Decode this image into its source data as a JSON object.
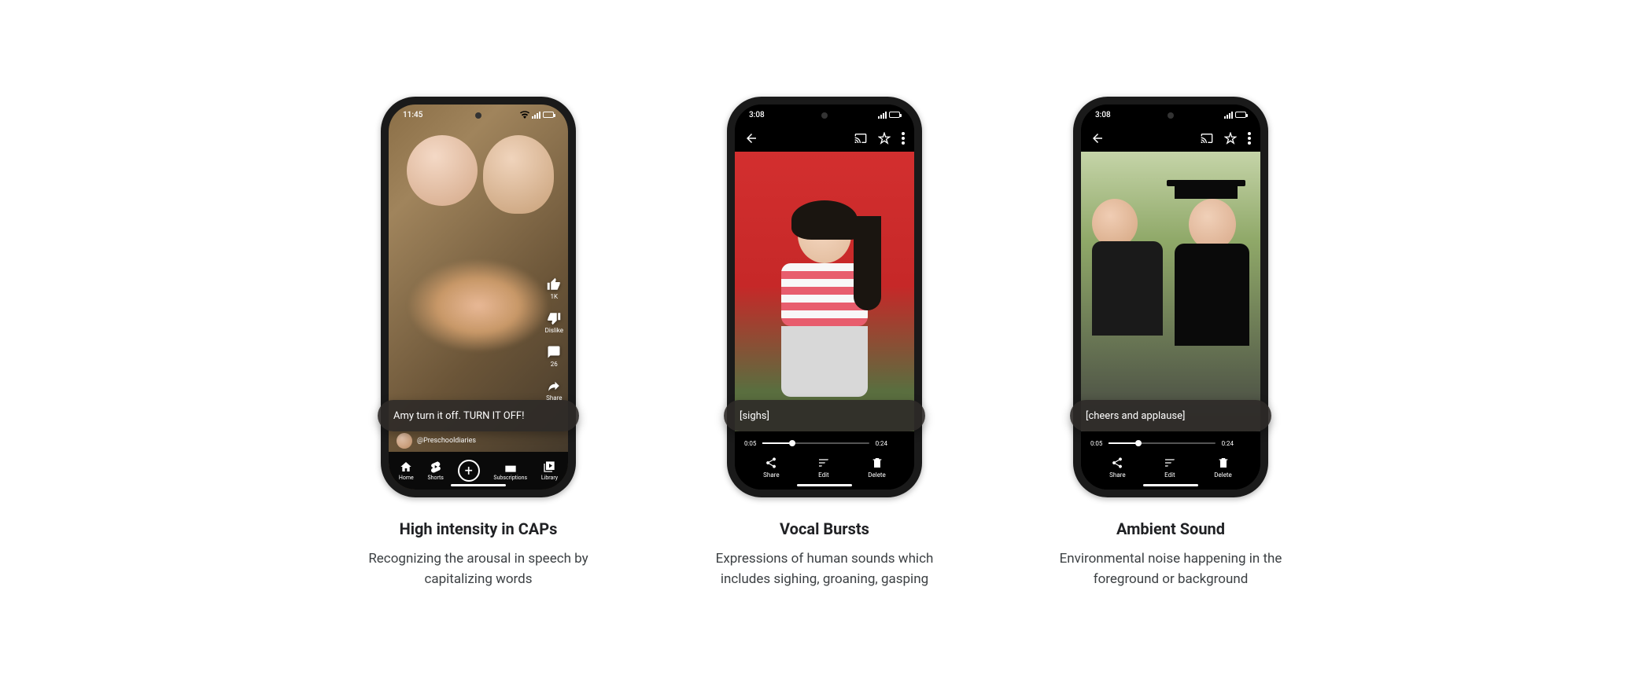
{
  "phones": [
    {
      "statusTime": "11:45",
      "caption": "Amy turn it off. TURN IT OFF!",
      "channel": "@Preschooldiaries",
      "actions": {
        "like": "1K",
        "dislike": "Dislike",
        "comments": "26",
        "share": "Share"
      },
      "nav": {
        "home": "Home",
        "shorts": "Shorts",
        "subs": "Subscriptions",
        "library": "Library"
      }
    },
    {
      "statusTime": "3:08",
      "caption": "[sighs]",
      "playerTimeStart": "0:05",
      "playerTimeEnd": "0:24",
      "buttons": {
        "share": "Share",
        "edit": "Edit",
        "delete": "Delete"
      }
    },
    {
      "statusTime": "3:08",
      "caption": "[cheers and applause]",
      "playerTimeStart": "0:05",
      "playerTimeEnd": "0:24",
      "buttons": {
        "share": "Share",
        "edit": "Edit",
        "delete": "Delete"
      }
    }
  ],
  "labels": [
    {
      "title": "High intensity in CAPs",
      "desc": "Recognizing the arousal in speech by capitalizing words"
    },
    {
      "title": "Vocal Bursts",
      "desc": "Expressions of human sounds which includes sighing, groaning, gasping"
    },
    {
      "title": "Ambient Sound",
      "desc": "Environmental noise happening in the foreground or background"
    }
  ]
}
